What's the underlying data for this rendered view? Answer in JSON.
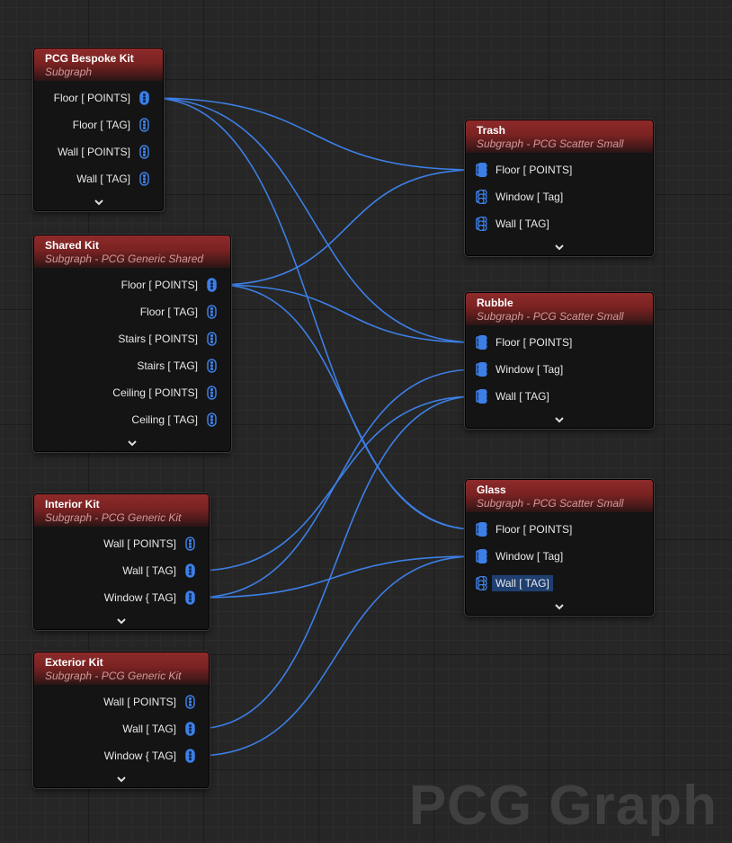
{
  "watermark": "PCG Graph",
  "wire_color": "#3d7fe6",
  "header_color": "#8e2a2a",
  "nodes": {
    "bespoke": {
      "title": "PCG Bespoke Kit",
      "subtitle": "Subgraph",
      "pins": [
        "Floor [ POINTS]",
        "Floor [ TAG]",
        "Wall [ POINTS]",
        "Wall [ TAG]"
      ]
    },
    "shared": {
      "title": "Shared Kit",
      "subtitle": "Subgraph - PCG Generic Shared",
      "pins": [
        "Floor [ POINTS]",
        "Floor [ TAG]",
        "Stairs [ POINTS]",
        "Stairs [ TAG]",
        "Ceiling [ POINTS]",
        "Ceiling [ TAG]"
      ]
    },
    "interior": {
      "title": "Interior Kit",
      "subtitle": "Subgraph - PCG Generic Kit",
      "pins": [
        "Wall [ POINTS]",
        "Wall [ TAG]",
        "Window { TAG]"
      ]
    },
    "exterior": {
      "title": "Exterior Kit",
      "subtitle": "Subgraph - PCG Generic Kit",
      "pins": [
        "Wall [ POINTS]",
        "Wall [ TAG]",
        "Window { TAG]"
      ]
    },
    "trash": {
      "title": "Trash",
      "subtitle": "Subgraph - PCG Scatter Small",
      "pins": [
        "Floor [ POINTS]",
        "Window [ Tag]",
        "Wall [ TAG]"
      ]
    },
    "rubble": {
      "title": "Rubble",
      "subtitle": "Subgraph - PCG Scatter Small",
      "pins": [
        "Floor [ POINTS]",
        "Window [ Tag]",
        "Wall [ TAG]"
      ]
    },
    "glass": {
      "title": "Glass",
      "subtitle": "Subgraph - PCG Scatter Small",
      "pins": [
        "Floor [ POINTS]",
        "Window [ Tag]",
        "Wall [ TAG]"
      ]
    }
  },
  "connections": [
    {
      "from": "bespoke.0",
      "to": "trash.0"
    },
    {
      "from": "bespoke.0",
      "to": "rubble.0"
    },
    {
      "from": "bespoke.0",
      "to": "glass.0"
    },
    {
      "from": "shared.0",
      "to": "trash.0"
    },
    {
      "from": "shared.0",
      "to": "rubble.0"
    },
    {
      "from": "shared.0",
      "to": "glass.0"
    },
    {
      "from": "interior.1",
      "to": "rubble.2"
    },
    {
      "from": "interior.2",
      "to": "rubble.1"
    },
    {
      "from": "interior.2",
      "to": "glass.1"
    },
    {
      "from": "exterior.1",
      "to": "rubble.2"
    },
    {
      "from": "exterior.2",
      "to": "glass.1"
    }
  ]
}
